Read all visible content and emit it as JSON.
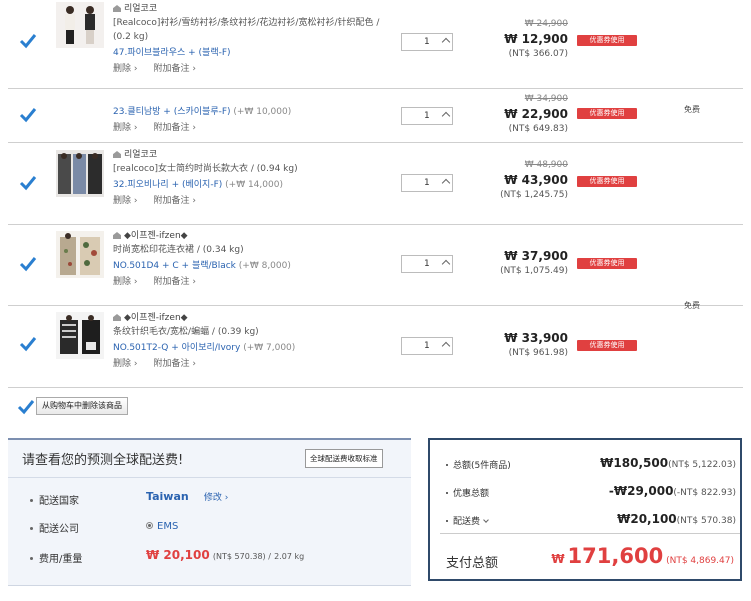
{
  "items": [
    {
      "seller": "리얼코코",
      "name": "[Realcoco]衬衫/雪纺衬衫/条纹衬衫/花边衬衫/宽松衬衫/针织配色 /",
      "weight": "(0.2 kg)",
      "option": "47.파이브블라우스 + (블랙-F)",
      "option_extra": "",
      "qty": "1",
      "orig_price": "₩ 24,900",
      "price": "₩ 12,900",
      "ntd": "(NT$ 366.07)",
      "coupon": "优惠券使用"
    },
    {
      "seller": "",
      "name": "",
      "weight": "",
      "option": "23.클티남방 + (스카이블루-F)",
      "option_extra": "(+₩ 10,000)",
      "qty": "1",
      "orig_price": "₩ 34,900",
      "price": "₩ 22,900",
      "ntd": "(NT$ 649.83)",
      "coupon": "优惠券使用"
    },
    {
      "seller": "리얼코코",
      "name": "[realcoco]女士简约时尚长款大衣 / (0.94 kg)",
      "weight": "",
      "option": "32.피오비나리 + (베이지-F)",
      "option_extra": "(+₩ 14,000)",
      "qty": "1",
      "orig_price": "₩ 48,900",
      "price": "₩ 43,900",
      "ntd": "(NT$ 1,245.75)",
      "coupon": "优惠券使用"
    },
    {
      "seller": "◆이프젠-ifzen◆",
      "name": "时尚宽松印花连衣裙 / (0.34 kg)",
      "weight": "",
      "option": "NO.501D4 + C + 블랙/Black",
      "option_extra": "(+₩ 8,000)",
      "qty": "1",
      "orig_price": "",
      "price": "₩ 37,900",
      "ntd": "(NT$ 1,075.49)",
      "coupon": "优惠券使用"
    },
    {
      "seller": "◆이프젠-ifzen◆",
      "name": "条纹针织毛衣/宽松/蝙蝠 / (0.39 kg)",
      "weight": "",
      "option": "NO.501T2-Q + 아이보리/Ivory",
      "option_extra": "(+₩ 7,000)",
      "qty": "1",
      "orig_price": "",
      "price": "₩ 33,900",
      "ntd": "(NT$ 961.98)",
      "coupon": "优惠券使用"
    }
  ],
  "item_links": {
    "delete": "删除 ›",
    "note": "附加备注 ›"
  },
  "free_shipping": "免费",
  "delete_selected": "从购物车中删除该商品",
  "shipping": {
    "title": "请查看您的预测全球配送费!",
    "standard_button": "全球配送费收取标准",
    "country_label": "配送国家",
    "country": "Taiwan",
    "edit": "修改 ›",
    "company_label": "配送公司",
    "company": "EMS",
    "fee_label": "费用/重量",
    "fee": "₩ 20,100",
    "fee_sub": "(NT$ 570.38) /",
    "weight": "2.07 kg"
  },
  "summary": {
    "total_label": "总额(5件商品)",
    "total": "₩180,500",
    "total_ntd": "(NT$ 5,122.03)",
    "discount_label": "优惠总额",
    "discount": "-₩29,000",
    "discount_ntd": "(-NT$ 822.93)",
    "shipping_label": "配送费",
    "shipping": "₩20,100",
    "shipping_ntd": "(NT$ 570.38)",
    "pay_label": "支付总额",
    "pay_currency": "₩",
    "pay": "171,600",
    "pay_ntd": "(NT$ 4,869.47)"
  },
  "colors": {
    "accent_red": "#e04040",
    "link_blue": "#2b63b0",
    "check_blue": "#2a7fd0"
  }
}
